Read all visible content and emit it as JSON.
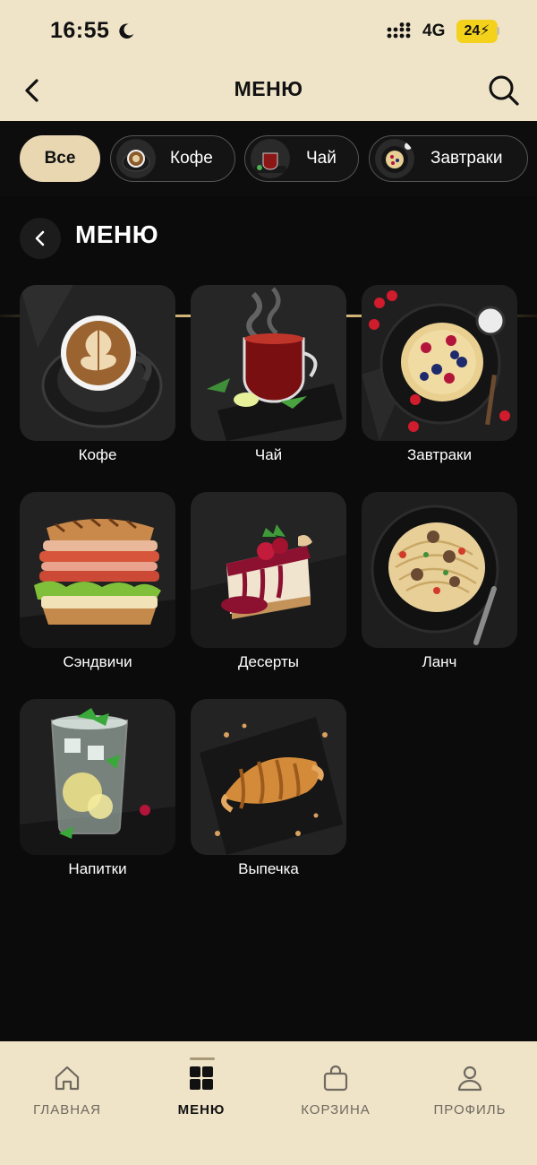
{
  "status_bar": {
    "time": "16:55",
    "network": "4G",
    "battery": "24"
  },
  "header": {
    "title": "МЕНЮ",
    "back_icon": "chevron-left-icon",
    "search_icon": "search-icon"
  },
  "chips": [
    {
      "label": "Все",
      "active": true
    },
    {
      "label": "Кофе",
      "active": false
    },
    {
      "label": "Чай",
      "active": false
    },
    {
      "label": "Завтраки",
      "active": false
    }
  ],
  "section": {
    "title": "МЕНЮ"
  },
  "categories": [
    {
      "label": "Кофе"
    },
    {
      "label": "Чай"
    },
    {
      "label": "Завтраки"
    },
    {
      "label": "Сэндвичи"
    },
    {
      "label": "Десерты"
    },
    {
      "label": "Ланч"
    },
    {
      "label": "Напитки"
    },
    {
      "label": "Выпечка"
    }
  ],
  "bottom_nav": [
    {
      "label": "ГЛАВНАЯ",
      "icon": "home-icon",
      "active": false
    },
    {
      "label": "МЕНЮ",
      "icon": "grid-icon",
      "active": true
    },
    {
      "label": "КОРЗИНА",
      "icon": "bag-icon",
      "active": false
    },
    {
      "label": "ПРОФИЛЬ",
      "icon": "user-icon",
      "active": false
    }
  ],
  "colors": {
    "cream": "#efe3c8",
    "background": "#0b0b0b",
    "accent_gold": "#c8a96a",
    "battery_yellow": "#f4d21b"
  }
}
